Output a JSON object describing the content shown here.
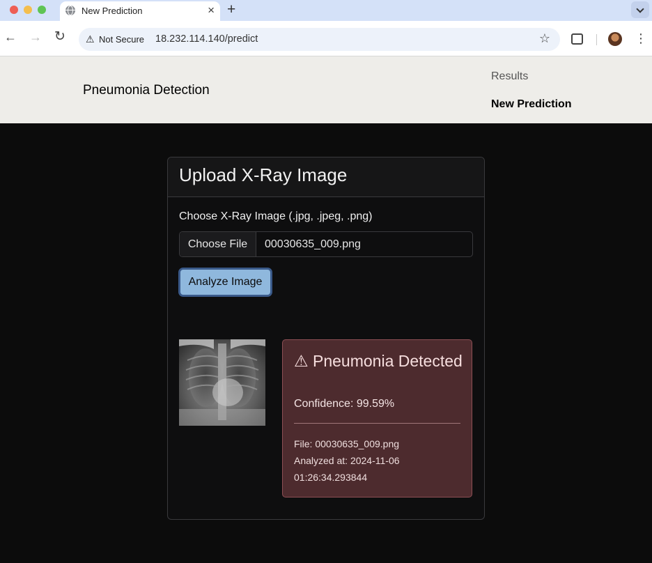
{
  "browser": {
    "tab_title": "New Prediction",
    "tab_close": "×",
    "new_tab": "+",
    "security_label": "Not Secure",
    "url": "18.232.114.140/predict"
  },
  "navbar": {
    "brand": "Pneumonia Detection",
    "links": [
      "Results",
      "New Prediction"
    ]
  },
  "card": {
    "title": "Upload X-Ray Image",
    "field_label": "Choose X-Ray Image (.jpg, .jpeg, .png)",
    "file_button": "Choose File",
    "file_name": "00030635_009.png",
    "analyze_button": "Analyze Image"
  },
  "result": {
    "title": "⚠ Pneumonia Detected",
    "confidence": "Confidence: 99.59%",
    "file": "File: 00030635_009.png",
    "analyzed_line1": "Analyzed at: 2024-11-06",
    "analyzed_line2": "01:26:34.293844",
    "status_color": "#4d2b2e"
  },
  "icons": {
    "back": "←",
    "forward": "→",
    "reload": "↻",
    "warning": "⚠",
    "star": "☆",
    "menu": "⋮"
  }
}
